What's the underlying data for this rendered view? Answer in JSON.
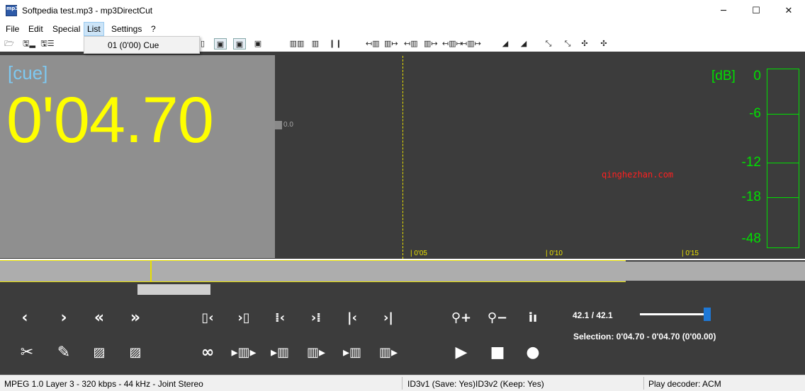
{
  "window": {
    "title": "Softpedia test.mp3 - mp3DirectCut",
    "app_icon_text": "mp3",
    "controls": {
      "minimize": "─",
      "maximize": "☐",
      "close": "✕"
    }
  },
  "menu": {
    "items": [
      "File",
      "Edit",
      "Special",
      "List",
      "Settings",
      "?"
    ],
    "active": "List",
    "dropdown": {
      "items": [
        "01  (0'00)  Cue"
      ]
    }
  },
  "toolbar": {
    "icons": [
      "open-folder-icon",
      "save-icon",
      "save-split-icon",
      "copy-icon",
      "doc-icon",
      "doc-a-icon",
      "doc-b-icon",
      "doc-c-icon",
      "align-icon",
      "bars-icon",
      "mark-icons",
      "zoom-icons"
    ]
  },
  "cue_panel": {
    "label": "[cue]",
    "time": "0'04.70"
  },
  "waveform": {
    "level_value": "0.0",
    "time_ticks": [
      "0'05",
      "0'10",
      "0'15"
    ],
    "watermark": "qinghezhan.com"
  },
  "meter": {
    "unit": "[dB]",
    "labels": [
      "0",
      "-6",
      "-12",
      "-18",
      "-48"
    ]
  },
  "playback": {
    "position": "42.1  /  42.1",
    "selection": "Selection: 0'04.70 - 0'04.70 (0'00.00)",
    "volume_level": 0.95
  },
  "status": {
    "format": "MPEG 1.0 Layer 3  -  320 kbps  -  44 kHz  -  Joint Stereo",
    "id3v1": "ID3v1 (Save: Yes)",
    "id3v2": "ID3v2 (Keep: Yes)",
    "decoder": "Play decoder: ACM"
  }
}
